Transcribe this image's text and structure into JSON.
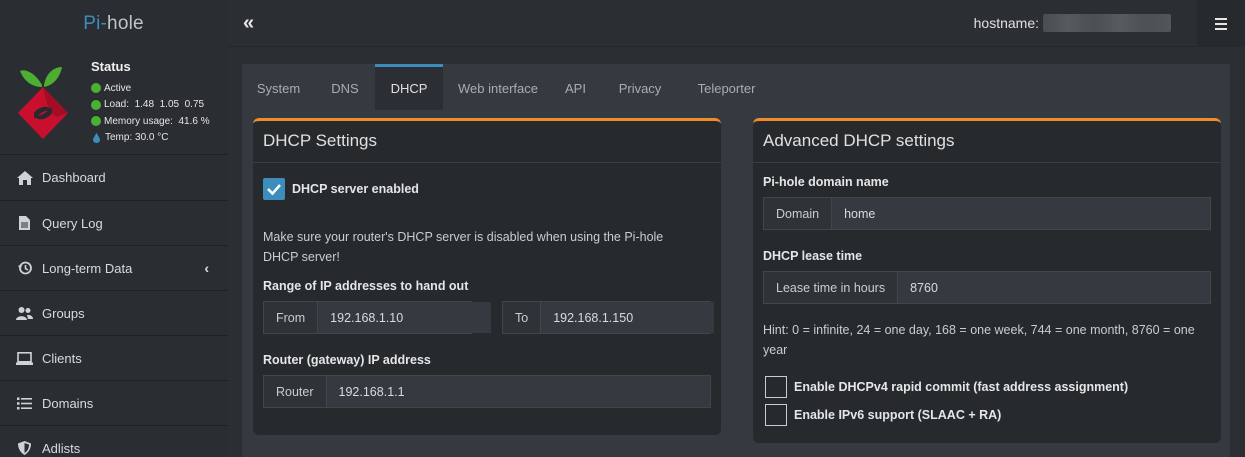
{
  "brand": {
    "prefix": "Pi-",
    "name": "hole"
  },
  "topbar": {
    "hostname_label": "hostname:"
  },
  "status": {
    "title": "Status",
    "active": "Active",
    "load": "Load:  1.48  1.05  0.75",
    "memory": "Memory usage:  41.6 %",
    "temp": "Temp: 30.0 °C"
  },
  "sidebar": {
    "items": [
      {
        "label": "Dashboard",
        "icon": "home-icon"
      },
      {
        "label": "Query Log",
        "icon": "file-icon"
      },
      {
        "label": "Long-term Data",
        "icon": "history-icon"
      },
      {
        "label": "Groups",
        "icon": "users-icon"
      },
      {
        "label": "Clients",
        "icon": "laptop-icon"
      },
      {
        "label": "Domains",
        "icon": "list-icon"
      },
      {
        "label": "Adlists",
        "icon": "shield-icon"
      }
    ]
  },
  "tabs": [
    "System",
    "DNS",
    "DHCP",
    "Web interface",
    "API",
    "Privacy",
    "Teleporter"
  ],
  "dhcp": {
    "title": "DHCP Settings",
    "enabled_label": "DHCP server enabled",
    "note_line1": "Make sure your router's DHCP server is disabled when using the Pi-hole",
    "note_line2": "DHCP server!",
    "range_label": "Range of IP addresses to hand out",
    "from_addon": "From",
    "from_value": "192.168.1.10",
    "to_addon": "To",
    "to_value": "192.168.1.150",
    "router_label": "Router (gateway) IP address",
    "router_addon": "Router",
    "router_value": "192.168.1.1"
  },
  "advanced": {
    "title": "Advanced DHCP settings",
    "domain_label": "Pi-hole domain name",
    "domain_addon": "Domain",
    "domain_value": "home",
    "lease_label": "DHCP lease time",
    "lease_addon": "Lease time in hours",
    "lease_value": "8760",
    "hint_line1": "Hint: 0 = infinite, 24 = one day, 168 = one week, 744 = one month, 8760 = one",
    "hint_line2": "year",
    "rapid_commit_label": "Enable DHCPv4 rapid commit (fast address assignment)",
    "ipv6_label": "Enable IPv6 support (SLAAC + RA)"
  },
  "colors": {
    "accent": "#3c8dbc",
    "box_border": "#f08c2a",
    "status_green": "#4caf32"
  }
}
